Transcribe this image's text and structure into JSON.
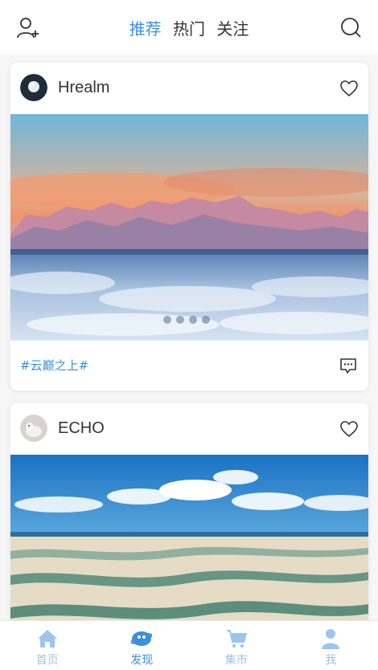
{
  "header": {
    "tabs": [
      {
        "label": "推荐",
        "active": true
      },
      {
        "label": "热门",
        "active": false
      },
      {
        "label": "关注",
        "active": false
      }
    ],
    "left_icon": "add-user-icon",
    "right_icon": "search-icon"
  },
  "feed": [
    {
      "username": "Hrealm",
      "tag": "#云巅之上#",
      "image": "sunset-mountains-above-clouds",
      "carousel_pages": 4
    },
    {
      "username": "ECHO",
      "image": "white-sand-dunes-blue-lagoons"
    }
  ],
  "bottom_nav": [
    {
      "label": "首页",
      "icon": "home-icon",
      "active": false
    },
    {
      "label": "发现",
      "icon": "discover-icon",
      "active": true
    },
    {
      "label": "集市",
      "icon": "cart-icon",
      "active": false
    },
    {
      "label": "我",
      "icon": "person-icon",
      "active": false
    }
  ],
  "colors": {
    "accent": "#3b8fe0",
    "inactive_nav": "#9cc4ec",
    "background": "#f6f6f7"
  }
}
